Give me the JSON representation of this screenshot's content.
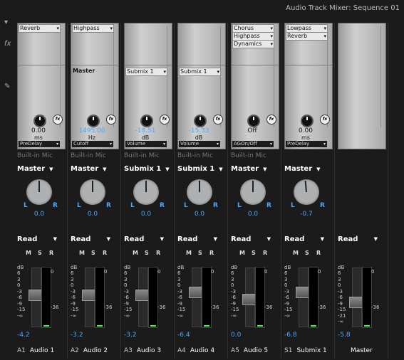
{
  "window": {
    "title": "Audio Track Mixer: Sequence 01"
  },
  "gutter": {
    "arrow_icon": "triangle-down",
    "fx_icon": "fx",
    "pencil_icon": "pencil"
  },
  "strips": [
    {
      "id": "A1",
      "name": "Audio 1",
      "effects": [
        "Reverb"
      ],
      "send": "",
      "value": "0.00",
      "unit": "ms",
      "value_blue": false,
      "param": "PreDelay",
      "input": "Built-in Mic",
      "output": "Master",
      "pan": "0.0",
      "pan_angle": 0,
      "automation": "Read",
      "level": "-4.2",
      "fader": 0.55
    },
    {
      "id": "A2",
      "name": "Audio 2",
      "effects": [
        "Highpass"
      ],
      "send": "Master",
      "value": "1495.00",
      "unit": "Hz",
      "value_blue": true,
      "param": "Cutoff",
      "input": "Built-in Mic",
      "output": "Master",
      "pan": "0.0",
      "pan_angle": 0,
      "automation": "Read",
      "level": "-3.2",
      "fader": 0.55
    },
    {
      "id": "A3",
      "name": "Audio 3",
      "effects": [],
      "send": "Submix 1",
      "value": "-18.51",
      "unit": "dB",
      "value_blue": true,
      "param": "Volume",
      "input": "Built-in Mic",
      "output": "Submix 1",
      "pan": "0.0",
      "pan_angle": 0,
      "automation": "Read",
      "level": "-3.2",
      "fader": 0.55
    },
    {
      "id": "A4",
      "name": "Audio 4",
      "effects": [],
      "send": "Submix 1",
      "value": "-15.33",
      "unit": "dB",
      "value_blue": true,
      "param": "Volume",
      "input": "Built-in Mic",
      "output": "Submix 1",
      "pan": "0.0",
      "pan_angle": 0,
      "automation": "Read",
      "level": "-6.4",
      "fader": 0.6
    },
    {
      "id": "A5",
      "name": "Audio 5",
      "effects": [
        "Chorus",
        "Highpass",
        "Dynamics"
      ],
      "send": "",
      "value": "Off",
      "unit": "",
      "value_blue": false,
      "param": "AGOn/Off",
      "input": "Built-in Mic",
      "output": "Master",
      "pan": "0.0",
      "pan_angle": 0,
      "automation": "Read",
      "level": "0.0",
      "fader": 0.45
    },
    {
      "id": "S1",
      "name": "Submix 1",
      "effects": [
        "Lowpass",
        "Reverb"
      ],
      "send": "",
      "value": "0.00",
      "unit": "ms",
      "value_blue": false,
      "param": "PreDelay",
      "input": "",
      "output": "Master",
      "pan": "-0.7",
      "pan_angle": -5,
      "automation": "Read",
      "level": "-6.8",
      "fader": 0.6
    },
    {
      "id": "",
      "name": "Master",
      "effects": [],
      "send": "",
      "value": "",
      "unit": "",
      "value_blue": false,
      "param": "",
      "input": "",
      "output": "",
      "pan": "",
      "pan_angle": 0,
      "automation": "Read",
      "level": "-5.8",
      "fader": 0.4
    }
  ],
  "labels": {
    "pan_l": "L",
    "pan_r": "R",
    "db": "dB",
    "mute": "M",
    "solo": "S",
    "record": "R",
    "meter_top": "0",
    "meter_bottom": "-36"
  },
  "fader_ticks": [
    "6",
    "3",
    "0",
    "-3",
    "-6",
    "-9",
    "-15",
    "-∞"
  ],
  "master_ticks": [
    "6",
    "3",
    "0",
    "-3",
    "-6",
    "-9",
    "-15",
    "-21",
    "-∞"
  ],
  "colors": {
    "accent": "#4aa7ff",
    "meter_green": "#33ff33"
  }
}
